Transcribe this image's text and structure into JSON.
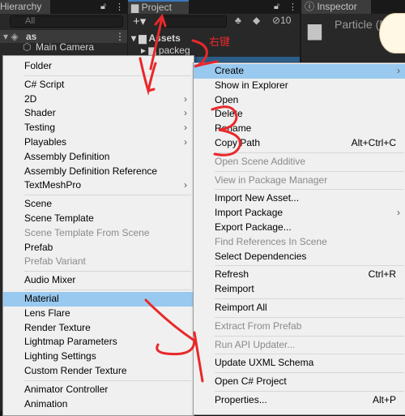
{
  "hierarchy": {
    "tab": "Hierarchy",
    "search_placeholder": "All",
    "scene": "as",
    "items": [
      "Main Camera"
    ]
  },
  "project": {
    "tab": "Project",
    "badge": "10",
    "folder_assets": "Assets",
    "folder_packeg": "packeg"
  },
  "inspector": {
    "tab": "Inspector",
    "title": "Particle (Default)"
  },
  "annotation": {
    "label": "右键",
    "color": "#e8282b"
  },
  "colors": {
    "highlight": "#99c9ef",
    "menu_bg": "#f0f0f0"
  },
  "create_menu": [
    {
      "label": "Folder"
    },
    {
      "sep": true
    },
    {
      "label": "C# Script"
    },
    {
      "label": "2D",
      "submenu": true
    },
    {
      "label": "Shader",
      "submenu": true
    },
    {
      "label": "Testing",
      "submenu": true
    },
    {
      "label": "Playables",
      "submenu": true
    },
    {
      "label": "Assembly Definition"
    },
    {
      "label": "Assembly Definition Reference"
    },
    {
      "label": "TextMeshPro",
      "submenu": true
    },
    {
      "sep": true
    },
    {
      "label": "Scene"
    },
    {
      "label": "Scene Template"
    },
    {
      "label": "Scene Template From Scene",
      "disabled": true
    },
    {
      "label": "Prefab"
    },
    {
      "label": "Prefab Variant",
      "disabled": true
    },
    {
      "sep": true
    },
    {
      "label": "Audio Mixer"
    },
    {
      "sep": true
    },
    {
      "label": "Material",
      "highlighted": true
    },
    {
      "label": "Lens Flare"
    },
    {
      "label": "Render Texture"
    },
    {
      "label": "Lightmap Parameters"
    },
    {
      "label": "Lighting Settings"
    },
    {
      "label": "Custom Render Texture"
    },
    {
      "sep": true
    },
    {
      "label": "Animator Controller"
    },
    {
      "label": "Animation"
    }
  ],
  "context_menu": [
    {
      "label": "Create",
      "submenu": true,
      "highlighted": true
    },
    {
      "label": "Show in Explorer"
    },
    {
      "label": "Open"
    },
    {
      "label": "Delete"
    },
    {
      "label": "Rename"
    },
    {
      "label": "Copy Path",
      "shortcut": "Alt+Ctrl+C"
    },
    {
      "sep": true
    },
    {
      "label": "Open Scene Additive",
      "disabled": true
    },
    {
      "sep": true
    },
    {
      "label": "View in Package Manager",
      "disabled": true
    },
    {
      "sep": true
    },
    {
      "label": "Import New Asset..."
    },
    {
      "label": "Import Package",
      "submenu": true
    },
    {
      "label": "Export Package..."
    },
    {
      "label": "Find References In Scene",
      "disabled": true
    },
    {
      "label": "Select Dependencies"
    },
    {
      "sep": true
    },
    {
      "label": "Refresh",
      "shortcut": "Ctrl+R"
    },
    {
      "label": "Reimport"
    },
    {
      "sep": true
    },
    {
      "label": "Reimport All"
    },
    {
      "sep": true
    },
    {
      "label": "Extract From Prefab",
      "disabled": true
    },
    {
      "sep": true
    },
    {
      "label": "Run API Updater...",
      "disabled": true
    },
    {
      "sep": true
    },
    {
      "label": "Update UXML Schema"
    },
    {
      "sep": true
    },
    {
      "label": "Open C# Project"
    },
    {
      "sep": true
    },
    {
      "label": "Properties...",
      "shortcut": "Alt+P"
    }
  ]
}
